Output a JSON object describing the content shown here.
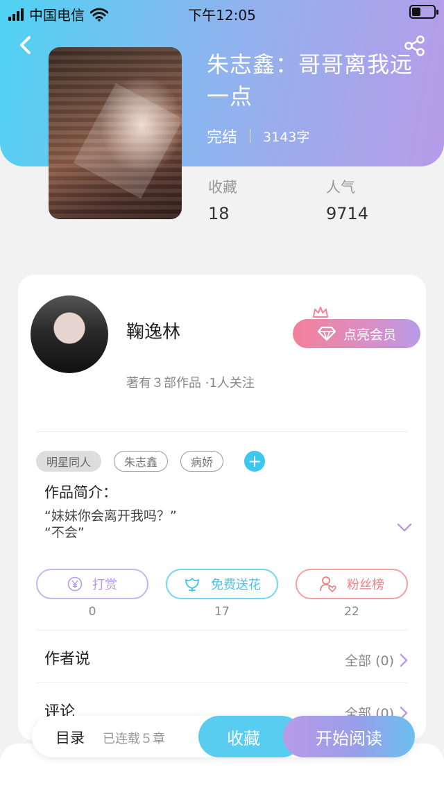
{
  "status_bar": {
    "carrier": "中国电信",
    "time": "下午12:05"
  },
  "book": {
    "title": "朱志鑫：哥哥离我远一点",
    "status": "完结",
    "word_count": "3143字"
  },
  "stats": [
    {
      "label": "收藏",
      "value": "18"
    },
    {
      "label": "人气",
      "value": "9714"
    }
  ],
  "author": {
    "name": "鞠逸林",
    "works_info": "著有３部作品 ·1人关注",
    "vip_label": "点亮会员"
  },
  "tags": [
    "明星同人",
    "朱志鑫",
    "病娇"
  ],
  "intro": {
    "title": "作品简介：",
    "line1": "“妹妹你会离开我吗？”",
    "line2": "“不会”"
  },
  "actions": [
    {
      "label": "打赏",
      "count": "0",
      "color": "#b79be8"
    },
    {
      "label": "免费送花",
      "count": "17",
      "color": "#3cc7ef"
    },
    {
      "label": "粉丝榜",
      "count": "22",
      "color": "#ee7f7f"
    }
  ],
  "sections": [
    {
      "title": "作者说",
      "link": "全部 (0)"
    },
    {
      "title": "评论",
      "link": "全部 (0)"
    }
  ],
  "bottom_bar": {
    "toc": "目录",
    "serial": "已连载５章",
    "collect": "收藏",
    "read": "开始阅读"
  },
  "icons": [
    "back-icon",
    "share-icon",
    "crown-icon",
    "diamond-icon",
    "plus-icon",
    "chevron-down-icon",
    "yen-icon",
    "flower-icon",
    "fan-icon",
    "chevron-right-icon"
  ],
  "colors": {
    "header_start": "#4fd3f2",
    "header_end": "#b79be8",
    "vip_start": "#f3819a",
    "accent_blue": "#3cc7ef"
  }
}
